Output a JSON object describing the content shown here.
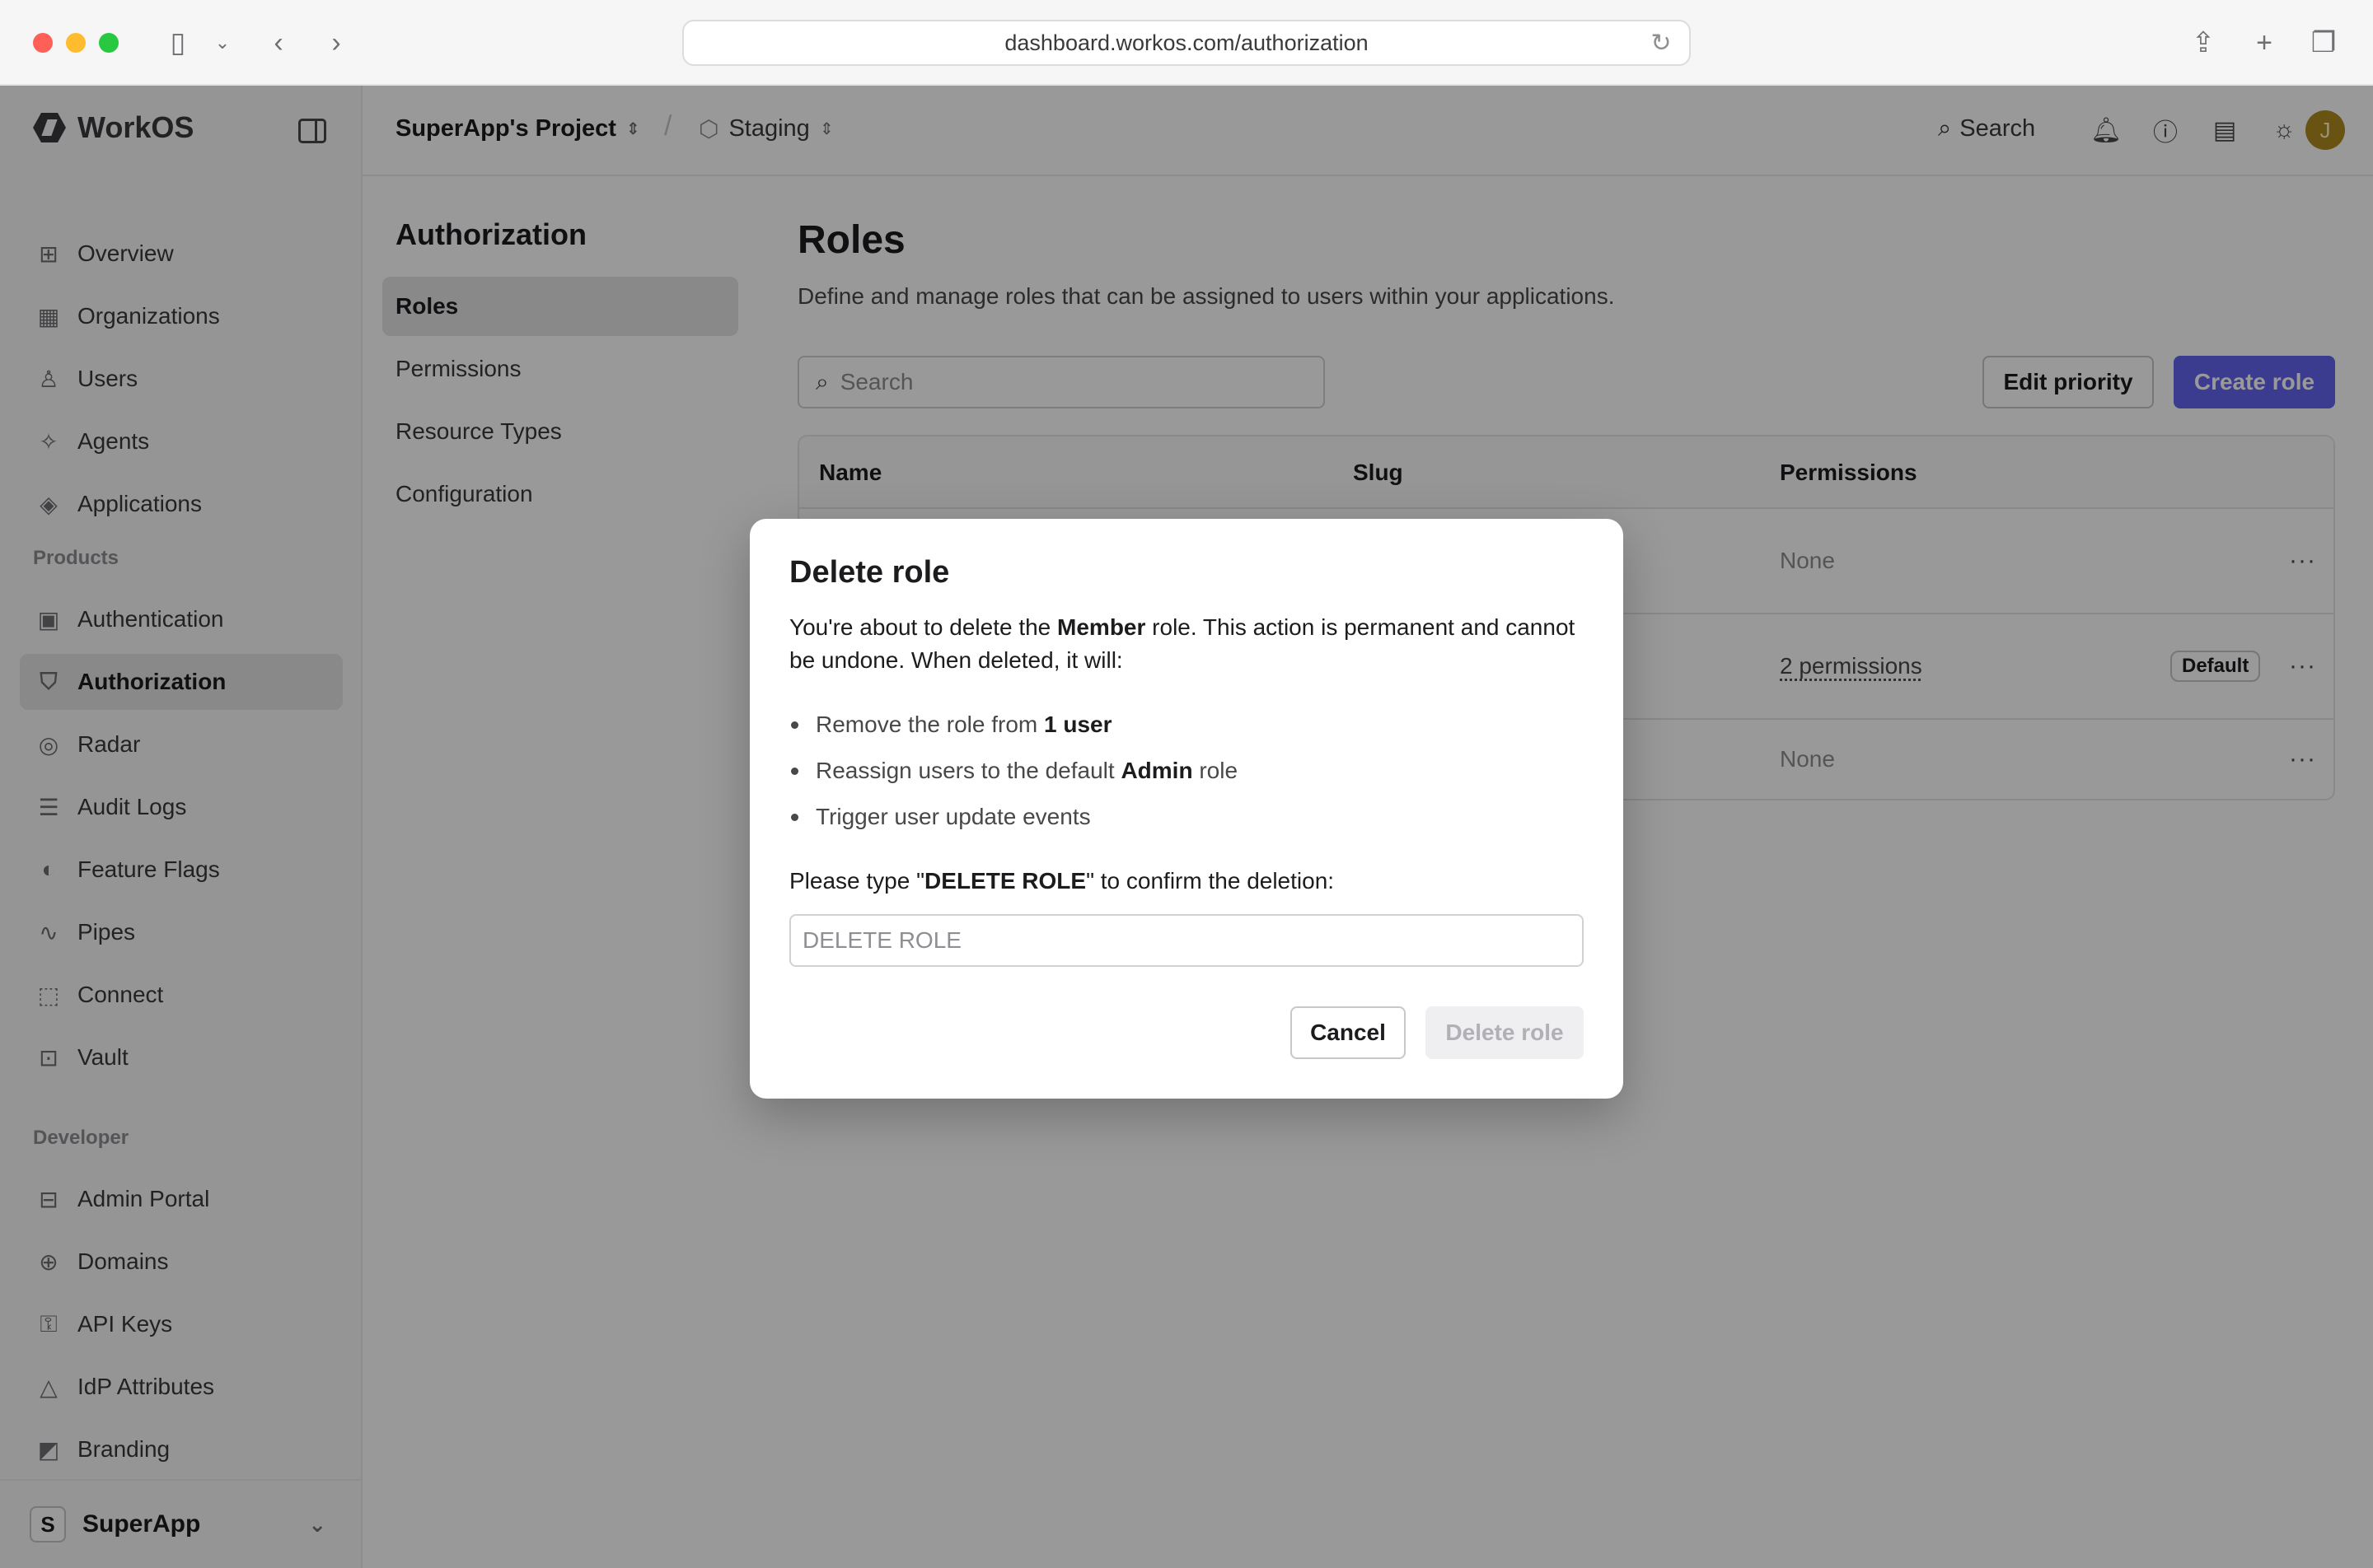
{
  "browser": {
    "url": "dashboard.workos.com/authorization"
  },
  "sidebar": {
    "brand": "WorkOS",
    "main_items": [
      {
        "label": "Overview",
        "icon": "grid-icon"
      },
      {
        "label": "Organizations",
        "icon": "building-icon"
      },
      {
        "label": "Users",
        "icon": "user-icon"
      },
      {
        "label": "Agents",
        "icon": "sparkle-icon"
      },
      {
        "label": "Applications",
        "icon": "layers-icon"
      }
    ],
    "products_label": "Products",
    "product_items": [
      {
        "label": "Authentication",
        "icon": "key-box-icon"
      },
      {
        "label": "Authorization",
        "icon": "shield-icon",
        "active": true
      },
      {
        "label": "Radar",
        "icon": "radar-icon"
      },
      {
        "label": "Audit Logs",
        "icon": "log-icon"
      },
      {
        "label": "Feature Flags",
        "icon": "toggle-icon"
      },
      {
        "label": "Pipes",
        "icon": "pipes-icon"
      },
      {
        "label": "Connect",
        "icon": "connect-icon"
      },
      {
        "label": "Vault",
        "icon": "vault-icon"
      }
    ],
    "developer_label": "Developer",
    "developer_items": [
      {
        "label": "Admin Portal",
        "icon": "portal-icon"
      },
      {
        "label": "Domains",
        "icon": "globe-icon"
      },
      {
        "label": "API Keys",
        "icon": "api-key-icon"
      },
      {
        "label": "IdP Attributes",
        "icon": "shapes-icon"
      },
      {
        "label": "Branding",
        "icon": "palette-icon"
      }
    ],
    "workspace": {
      "initial": "S",
      "name": "SuperApp"
    }
  },
  "topbar": {
    "project": "SuperApp's Project",
    "separator": "/",
    "environment": "Staging",
    "search_label": "Search",
    "avatar_initial": "J"
  },
  "subnav": {
    "title": "Authorization",
    "items": [
      {
        "label": "Roles",
        "active": true
      },
      {
        "label": "Permissions"
      },
      {
        "label": "Resource Types"
      },
      {
        "label": "Configuration"
      }
    ]
  },
  "main": {
    "title": "Roles",
    "description": "Define and manage roles that can be assigned to users within your applications.",
    "search_placeholder": "Search",
    "edit_priority": "Edit priority",
    "create_role": "Create role",
    "table": {
      "columns": [
        "Name",
        "Slug",
        "Permissions"
      ],
      "rows": [
        {
          "permissions": "None",
          "default": ""
        },
        {
          "permissions": "2 permissions",
          "default": "Default"
        },
        {
          "permissions": "None",
          "default": ""
        }
      ],
      "more": "···"
    }
  },
  "modal": {
    "title": "Delete role",
    "intro_before": "You're about to delete the ",
    "intro_role": "Member",
    "intro_after": " role. This action is permanent and cannot be undone. When deleted, it will:",
    "bullets": [
      {
        "text": "Remove the role from ",
        "bold": "1 user",
        "after": ""
      },
      {
        "text": "Reassign users to the default ",
        "bold": "Admin",
        "after": " role"
      },
      {
        "text": "Trigger user update events",
        "bold": "",
        "after": ""
      }
    ],
    "confirm_before": "Please type \"",
    "confirm_phrase": "DELETE ROLE",
    "confirm_after": "\" to confirm the deletion:",
    "input_placeholder": "DELETE ROLE",
    "cancel": "Cancel",
    "delete": "Delete role"
  },
  "colors": {
    "primary": "#6363f1",
    "avatar": "#b08a1e"
  }
}
